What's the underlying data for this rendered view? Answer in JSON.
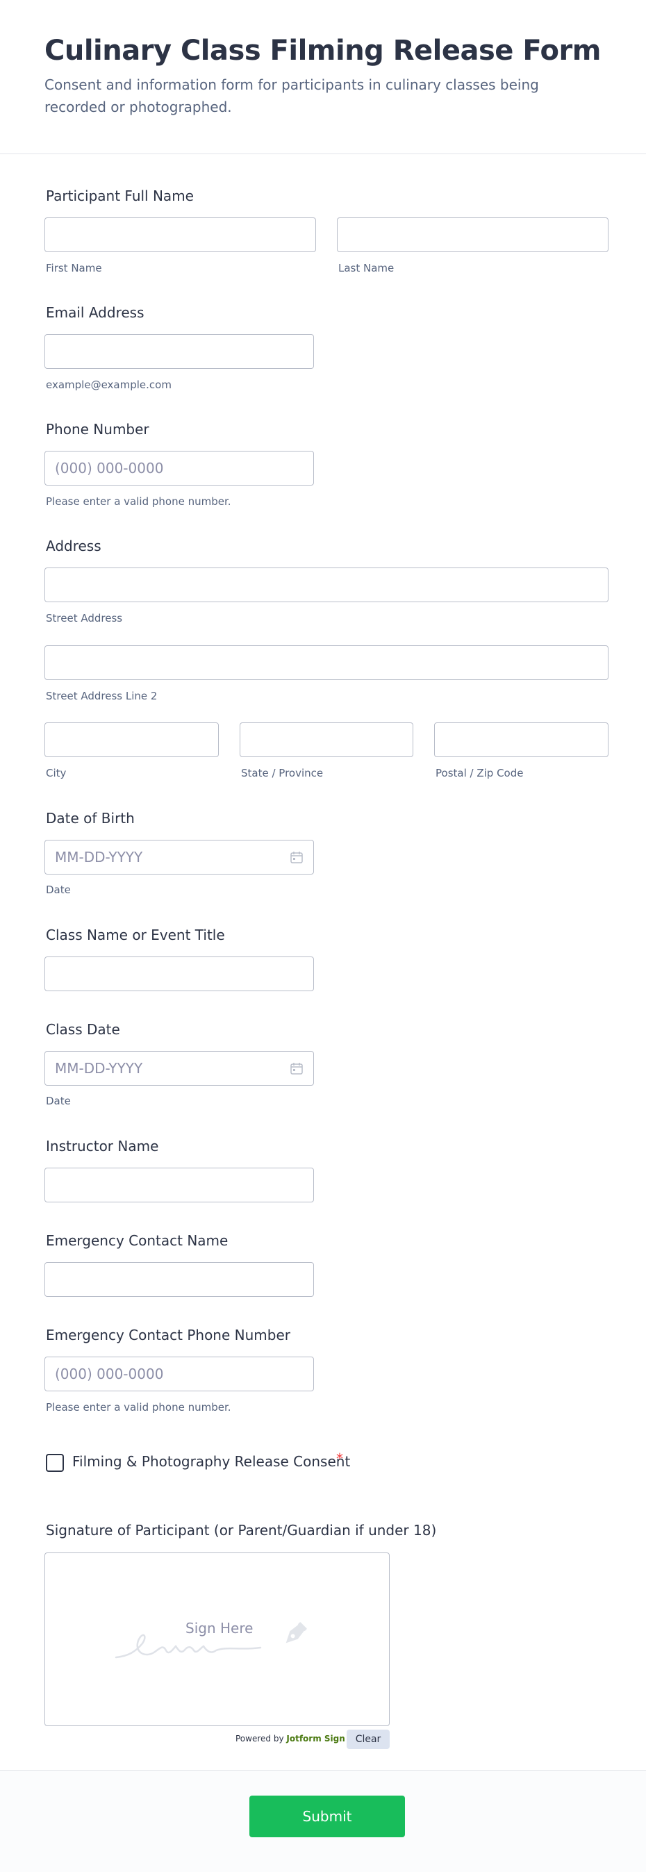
{
  "header": {
    "title": "Culinary Class Filming Release Form",
    "subtitle": "Consent and information form for participants in culinary classes being recorded or photographed."
  },
  "fields": {
    "full_name": {
      "label": "Participant Full Name",
      "first_sublabel": "First Name",
      "last_sublabel": "Last Name"
    },
    "email": {
      "label": "Email Address",
      "sublabel": "example@example.com"
    },
    "phone": {
      "label": "Phone Number",
      "placeholder": "(000) 000-0000",
      "sublabel": "Please enter a valid phone number."
    },
    "address": {
      "label": "Address",
      "street_sublabel": "Street Address",
      "street2_sublabel": "Street Address Line 2",
      "city_sublabel": "City",
      "state_sublabel": "State / Province",
      "zip_sublabel": "Postal / Zip Code"
    },
    "dob": {
      "label": "Date of Birth",
      "placeholder": "MM-DD-YYYY",
      "sublabel": "Date"
    },
    "class_name": {
      "label": "Class Name or Event Title"
    },
    "class_date": {
      "label": "Class Date",
      "placeholder": "MM-DD-YYYY",
      "sublabel": "Date"
    },
    "instructor": {
      "label": "Instructor Name"
    },
    "emergency_name": {
      "label": "Emergency Contact Name"
    },
    "emergency_phone": {
      "label": "Emergency Contact Phone Number",
      "placeholder": "(000) 000-0000",
      "sublabel": "Please enter a valid phone number."
    },
    "consent": {
      "label": "Filming & Photography Release Consent",
      "required_mark": "*"
    },
    "signature": {
      "label": "Signature of Participant (or Parent/Guardian if under 18)",
      "hint": "Sign Here",
      "powered_prefix": "Powered by ",
      "powered_brand": "Jotform Sign",
      "clear_label": "Clear"
    }
  },
  "footer": {
    "submit_label": "Submit"
  },
  "colors": {
    "text": "#2c3345",
    "muted": "#57647e",
    "placeholder": "#8d8fa8",
    "border": "#b8bdc9",
    "submit": "#18bd5b",
    "required": "#f23a3c",
    "brand_green": "#4b7a12"
  },
  "icons": {
    "date_picker": "calendar-icon",
    "signature": "pen-nib-icon"
  }
}
